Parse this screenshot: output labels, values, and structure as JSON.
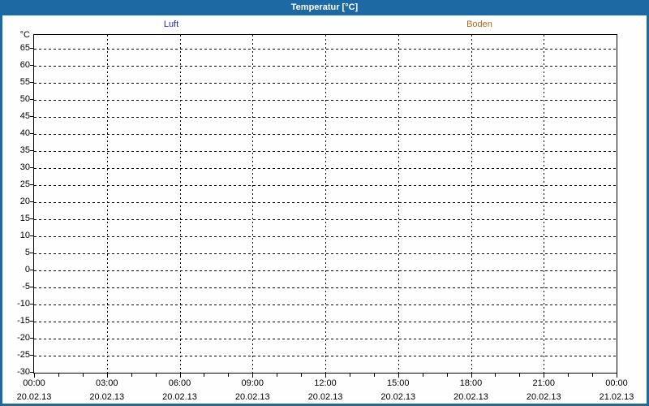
{
  "window": {
    "title": "Temperatur [°C]"
  },
  "colors": {
    "frame_blue": "#1d69a4",
    "titlebar_text": "#ffffff",
    "luft_series": "#2222cc",
    "boden_series": "#a86a19",
    "grid": "#000000",
    "background": "#fdfefd"
  },
  "chart_data": {
    "type": "line",
    "title": "Temperatur [°C]",
    "series": [
      {
        "name": "Luft",
        "color": "#2222cc",
        "values": []
      },
      {
        "name": "Boden",
        "color": "#a86a19",
        "values": []
      }
    ],
    "y_axis": {
      "unit": "°C",
      "min": -30,
      "max": 65,
      "tick_step": 5,
      "tick_labels": [
        "65",
        "60",
        "55",
        "50",
        "45",
        "40",
        "35",
        "30",
        "25",
        "20",
        "15",
        "10",
        "5",
        "0",
        "-5",
        "-10",
        "-15",
        "-20",
        "-25",
        "-30"
      ],
      "grid": true
    },
    "x_axis": {
      "total_hours": 24,
      "major_step_hours": 3,
      "minor_step_hours": 1,
      "grid": true,
      "ticks": [
        {
          "time": "00:00",
          "date": "20.02.13"
        },
        {
          "time": "03:00",
          "date": "20.02.13"
        },
        {
          "time": "06:00",
          "date": "20.02.13"
        },
        {
          "time": "09:00",
          "date": "20.02.13"
        },
        {
          "time": "12:00",
          "date": "20.02.13"
        },
        {
          "time": "15:00",
          "date": "20.02.13"
        },
        {
          "time": "18:00",
          "date": "20.02.13"
        },
        {
          "time": "21:00",
          "date": "20.02.13"
        },
        {
          "time": "00:00",
          "date": "21.02.13"
        }
      ]
    },
    "legend_position": "top",
    "notes_plotted_points": "none"
  }
}
